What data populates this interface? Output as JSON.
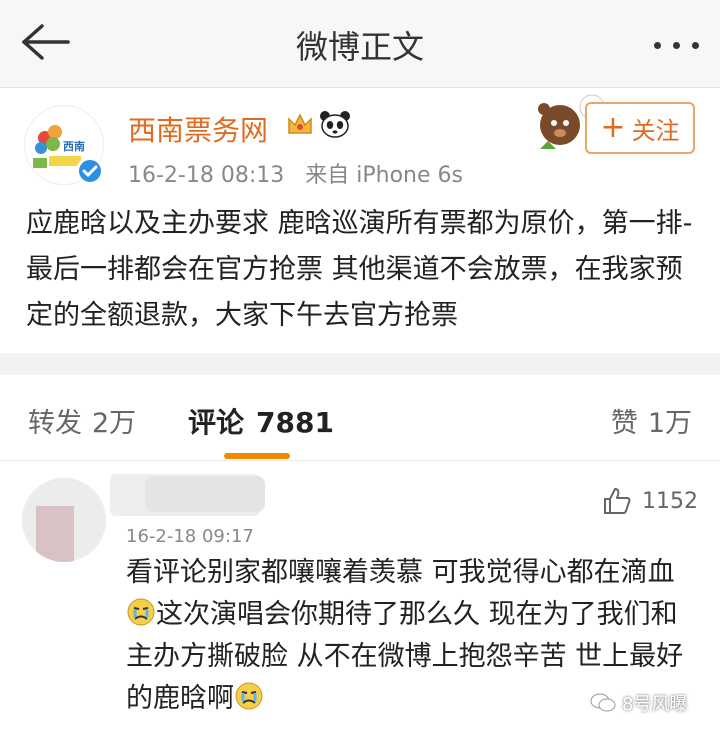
{
  "header": {
    "title": "微博正文"
  },
  "post": {
    "author": "西南票务网",
    "avatar_logo_text": "西南",
    "time": "16-2-18 08:13",
    "source": "来自 iPhone 6s",
    "follow_label": "关注",
    "text": "应鹿晗以及主办要求 鹿晗巡演所有票都为原价，第一排-最后一排都会在官方抢票 其他渠道不会放票，在我家预定的全额退款，大家下午去官方抢票"
  },
  "tabs": {
    "repost_label": "转发",
    "repost_count": "2万",
    "comment_label": "评论",
    "comment_count": "7881",
    "like_label": "赞",
    "like_count": "1万"
  },
  "comment": {
    "time": "16-2-18 09:17",
    "like_count": "1152",
    "text_part1": "看评论别家都嚷嚷着羡慕 可我觉得心都在滴血",
    "text_part2": "这次演唱会你期待了那么久 现在为了我们和主办方撕破脸 从不在微博上抱怨辛苦 世上最好的鹿晗啊"
  },
  "watermark": {
    "text": "8号风曝"
  },
  "colors": {
    "accent_orange": "#e06b1f",
    "tab_underline": "#f08a00",
    "verified_blue": "#2e8fe6"
  },
  "icons": [
    "back-arrow-icon",
    "more-dots-icon",
    "crown-icon",
    "panda-icon",
    "verified-icon",
    "plus-icon",
    "thumbs-up-icon",
    "crying-emoji-icon",
    "wechat-icon"
  ]
}
